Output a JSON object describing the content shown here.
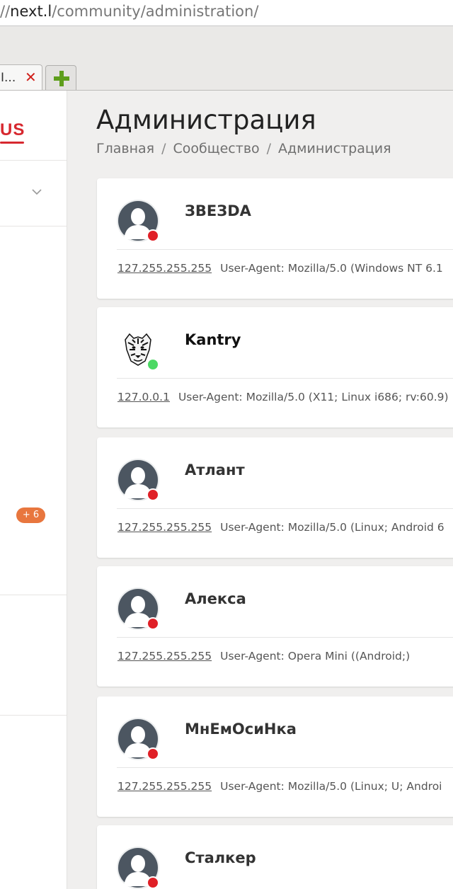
{
  "browser": {
    "url_prefix": "//",
    "url_host": "next.l",
    "url_path": "/community/administration/",
    "tab_title": "I...",
    "tab_close": "✕"
  },
  "sidebar": {
    "logo_text": "US",
    "badge": "+ 6"
  },
  "page": {
    "title": "Администрация",
    "breadcrumb": [
      "Главная",
      "Сообщество",
      "Администрация"
    ],
    "breadcrumb_sep": "/"
  },
  "colors": {
    "online": "#4cd964",
    "offline": "#e02027",
    "accent": "#d7282f",
    "badge": "#e8763e"
  },
  "users": [
    {
      "name": "ЗВЕЗDA",
      "ip": "127.255.255.255",
      "agent": "User-Agent: Mozilla/5.0 (Windows NT 6.1",
      "status": "offline",
      "avatar": "default-avatar"
    },
    {
      "name": "Kantry",
      "ip": "127.0.0.1",
      "agent": "User-Agent: Mozilla/5.0 (X11; Linux i686; rv:60.9)",
      "status": "online",
      "avatar": "tiger-avatar"
    },
    {
      "name": "Атлант",
      "ip": "127.255.255.255",
      "agent": "User-Agent: Mozilla/5.0 (Linux; Android 6",
      "status": "offline",
      "avatar": "default-avatar"
    },
    {
      "name": "Алекса",
      "ip": "127.255.255.255",
      "agent": "User-Agent: Opera Mini ((Android;)",
      "status": "offline",
      "avatar": "default-avatar"
    },
    {
      "name": "МнЕмОсиНка",
      "ip": "127.255.255.255",
      "agent": "User-Agent: Mozilla/5.0 (Linux; U; Androi",
      "status": "offline",
      "avatar": "default-avatar"
    },
    {
      "name": "Сталкер",
      "ip": "",
      "agent": "",
      "status": "offline",
      "avatar": "default-avatar"
    }
  ]
}
